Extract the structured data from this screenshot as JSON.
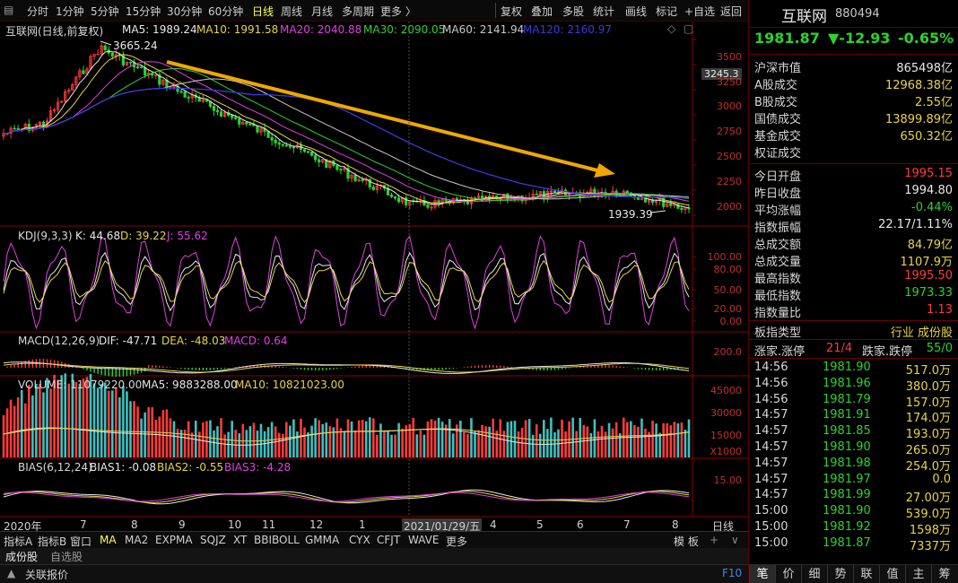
{
  "toolbar": {
    "periods": [
      "分时",
      "1分钟",
      "5分钟",
      "15分钟",
      "30分钟",
      "60分钟",
      "日线",
      "周线",
      "月线",
      "多周期",
      "更多 〉"
    ],
    "active_period": "日线",
    "right_buttons": [
      "复权",
      "叠加",
      "多股",
      "统计",
      "画线",
      "标记",
      "+自选",
      "返回"
    ]
  },
  "main_chart": {
    "title": "互联网(日线,前复权)",
    "ma5": "MA5: 1989.24",
    "ma10": "MA10: 1991.58",
    "ma20": "MA20: 2040.88",
    "ma30": "MA30: 2090.05",
    "ma60": "MA60: 2141.94",
    "ma120": "MA120: 2160.97",
    "high_label": "3665.24",
    "low_label": "1939.39",
    "price_marker": "3245.3",
    "y_ticks": [
      "3500",
      "3250",
      "3000",
      "2750",
      "2500",
      "2250",
      "2000"
    ]
  },
  "kdj": {
    "title": "KDJ(9,3,3)",
    "k": "K: 44.68",
    "d": "D: 39.22",
    "j": "J: 55.62",
    "y_ticks": [
      "100.00",
      "80.00",
      "50.00",
      "20.00",
      "0.00"
    ]
  },
  "macd": {
    "title": "MACD(12,26,9)",
    "dif": "DIF: -47.71",
    "dea": "DEA: -48.03",
    "macd": "MACD: 0.64",
    "y_tick": "200.0"
  },
  "volume": {
    "title": "VOLUME: 11079220.00",
    "ma5": "MA5: 9883288.00",
    "ma10": "MA10: 10821023.00",
    "y_ticks": [
      "45000",
      "30000",
      "15000"
    ],
    "unit": "X1000"
  },
  "bias": {
    "title": "BIAS(6,12,24)",
    "bias1": "BIAS1: -0.08",
    "bias2": "BIAS2: -0.55",
    "bias3": "BIAS3: -4.28",
    "y_tick": "15.00"
  },
  "x_axis": {
    "labels": [
      "2020年",
      "7",
      "8",
      "9",
      "10",
      "11",
      "12",
      "1",
      "2021/01/29/五",
      "4",
      "5",
      "6",
      "7",
      "8"
    ],
    "period_label": "日线"
  },
  "indicator_bar": {
    "items": [
      "指标A",
      "指标B",
      "窗口",
      "MA",
      "MA2",
      "EXPMA",
      "SQJZ",
      "XT",
      "BBIBOLL",
      "GMMA",
      "CYX",
      "CFJT",
      "WAVE",
      "更多"
    ],
    "active": "MA",
    "right": [
      "模 板",
      "+",
      "∨"
    ]
  },
  "tabs": [
    "成份股",
    "自选股"
  ],
  "status": {
    "left": "关联报价",
    "right": "F10"
  },
  "panel": {
    "name": "互联网",
    "code": "880494",
    "price": "1981.87",
    "change": "▼-12.93",
    "pct": "-0.65%",
    "stats": [
      {
        "k": "沪深市值",
        "v": "865498亿",
        "c": "white"
      },
      {
        "k": "A股成交",
        "v": "12968.38亿",
        "c": "yellow"
      },
      {
        "k": "B股成交",
        "v": "2.55亿",
        "c": "yellow"
      },
      {
        "k": "国债成交",
        "v": "13899.89亿",
        "c": "yellow"
      },
      {
        "k": "基金成交",
        "v": "650.32亿",
        "c": "yellow"
      },
      {
        "k": "权证成交",
        "v": "",
        "c": "yellow"
      }
    ],
    "stats2": [
      {
        "k": "今日开盘",
        "v": "1995.15",
        "c": "red"
      },
      {
        "k": "昨日收盘",
        "v": "1994.80",
        "c": "white"
      },
      {
        "k": "平均涨幅",
        "v": "-0.44%",
        "c": "green"
      },
      {
        "k": "指数振幅",
        "v": "22.17/1.11%",
        "c": "white"
      },
      {
        "k": "总成交额",
        "v": "84.79亿",
        "c": "yellow"
      },
      {
        "k": "总成交量",
        "v": "1107.9万",
        "c": "yellow"
      },
      {
        "k": "最高指数",
        "v": "1995.50",
        "c": "red"
      },
      {
        "k": "最低指数",
        "v": "1973.33",
        "c": "green"
      },
      {
        "k": "指数量比",
        "v": "1.13",
        "c": "red"
      }
    ],
    "plate_type_k": "板指类型",
    "plate_type_v": "行业  成份股",
    "updown": {
      "k1": "涨家.涨停",
      "v1": "21/4",
      "k2": "跌家.跌停",
      "v2": "55/0"
    },
    "ticks": [
      {
        "t": "14:56",
        "p": "1981.90",
        "v": "517.0万"
      },
      {
        "t": "14:56",
        "p": "1981.96",
        "v": "380.0万"
      },
      {
        "t": "14:56",
        "p": "1981.79",
        "v": "157.0万"
      },
      {
        "t": "14:57",
        "p": "1981.91",
        "v": "174.0万"
      },
      {
        "t": "14:57",
        "p": "1981.85",
        "v": "193.0万"
      },
      {
        "t": "14:57",
        "p": "1981.90",
        "v": "265.0万"
      },
      {
        "t": "14:57",
        "p": "1981.98",
        "v": "254.0万"
      },
      {
        "t": "14:57",
        "p": "1981.97",
        "v": "0.0"
      },
      {
        "t": "14:57",
        "p": "1981.99",
        "v": "27.00万"
      },
      {
        "t": "15:00",
        "p": "1981.90",
        "v": "539.0万"
      },
      {
        "t": "15:00",
        "p": "1981.92",
        "v": "1598万"
      },
      {
        "t": "15:00",
        "p": "1981.87",
        "v": "7337万"
      }
    ],
    "bottom_tabs": [
      "笔",
      "价",
      "细",
      "势",
      "联",
      "值",
      "主",
      "筹"
    ]
  },
  "colors": {
    "up": "#ff3b3b",
    "down": "#2cd32c",
    "accent": "#e8d44a",
    "arrow": "#f0a800"
  }
}
